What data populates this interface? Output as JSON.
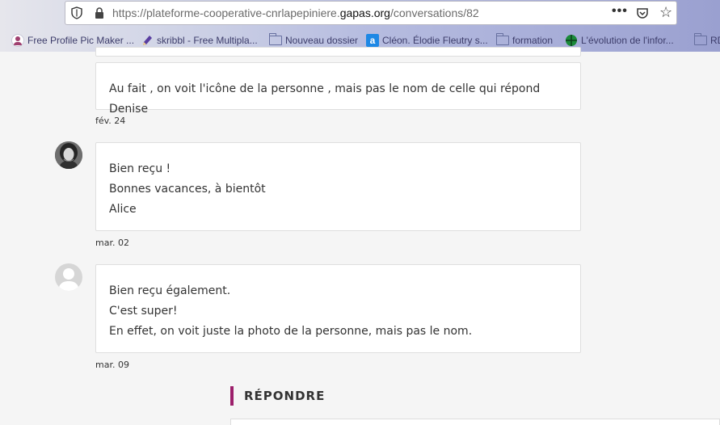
{
  "browser": {
    "url_prefix": "https://plateforme-cooperative-cnrlapepiniere.",
    "url_host": "gapas.org",
    "url_path": "/conversations/82",
    "more_label": "•••",
    "bookmarks": [
      {
        "label": "Free Profile Pic Maker ...",
        "icon": "profile-pic-icon",
        "color": "#e8e8f0"
      },
      {
        "label": "skribbl - Free Multipla...",
        "icon": "pencil-icon",
        "color": "#5a3ea0"
      },
      {
        "label": "Nouveau dossier",
        "icon": "folder-icon"
      },
      {
        "label": "Cléon. Élodie Fleutry s...",
        "icon": "a-logo-icon",
        "color": "#1e88e5"
      },
      {
        "label": "formation",
        "icon": "folder-icon"
      },
      {
        "label": "L'évolution de l'infor...",
        "icon": "green-globe-icon",
        "color": "#1b8a3a"
      },
      {
        "label": "RD",
        "icon": "folder-icon"
      }
    ]
  },
  "messages": [
    {
      "lines": [
        "Au fait , on voit l'icône de la personne , mais pas le nom de celle qui répond Denise"
      ],
      "date": "fév. 24",
      "avatar": "none"
    },
    {
      "lines": [
        "Bien reçu !",
        "Bonnes vacances, à bientôt",
        "Alice"
      ],
      "date": "mar. 02",
      "avatar": "photo"
    },
    {
      "lines": [
        "Bien reçu également.",
        "C'est super!",
        "En effet, on voit juste la photo de la personne, mais pas le nom."
      ],
      "date": "mar. 09",
      "avatar": "default"
    }
  ],
  "reply": {
    "heading": "RÉPONDRE",
    "accent": "#9c1f6b"
  }
}
